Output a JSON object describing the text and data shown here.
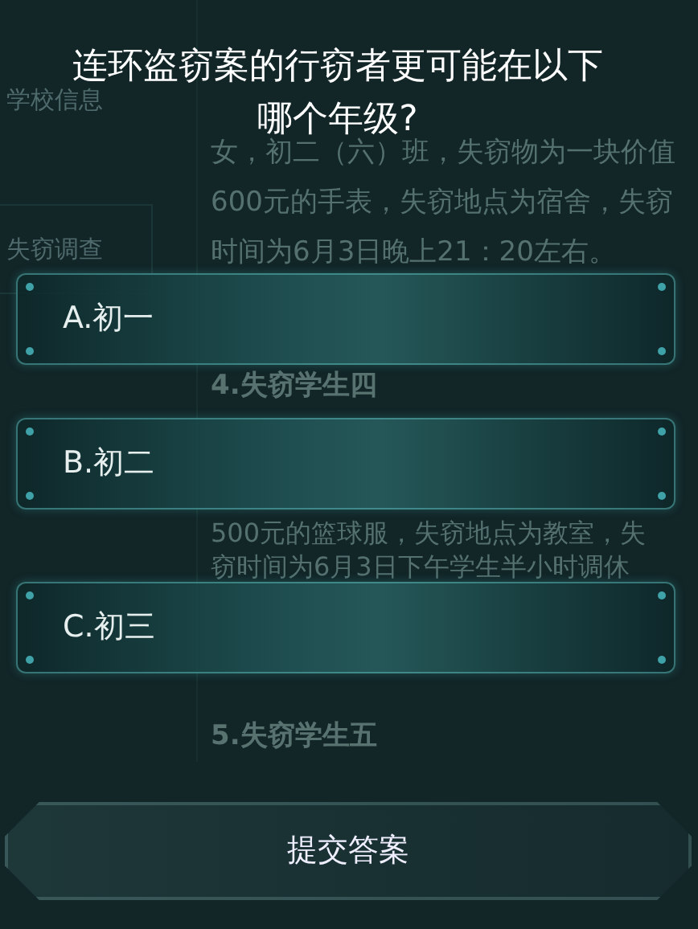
{
  "sidebar": {
    "items": [
      {
        "label": "学校信息",
        "selected": false
      },
      {
        "label": "失窃调查",
        "selected": true
      }
    ]
  },
  "document": {
    "sections": [
      {
        "lines": [
          "女，初二（六）班，失窃物为一块价值",
          "600元的手表，失窃地点为宿舍，失窃",
          "时间为6月3日晚上21：20左右。"
        ]
      },
      {
        "heading": "4.失窃学生四",
        "lines": [
          "500元的篮球服，失窃地点为教室，失",
          "窃时间为6月3日下午学生半小时调休"
        ]
      },
      {
        "heading": "5.失窃学生五"
      }
    ]
  },
  "dialog": {
    "question": [
      "连环盗窃案的行窃者更可能在以下",
      "哪个年级?"
    ],
    "options": [
      {
        "label": "A.初一",
        "selected": false
      },
      {
        "label": "B.初二",
        "selected": false
      },
      {
        "label": "C.初三",
        "selected": false
      }
    ],
    "submit": "提交答案"
  }
}
